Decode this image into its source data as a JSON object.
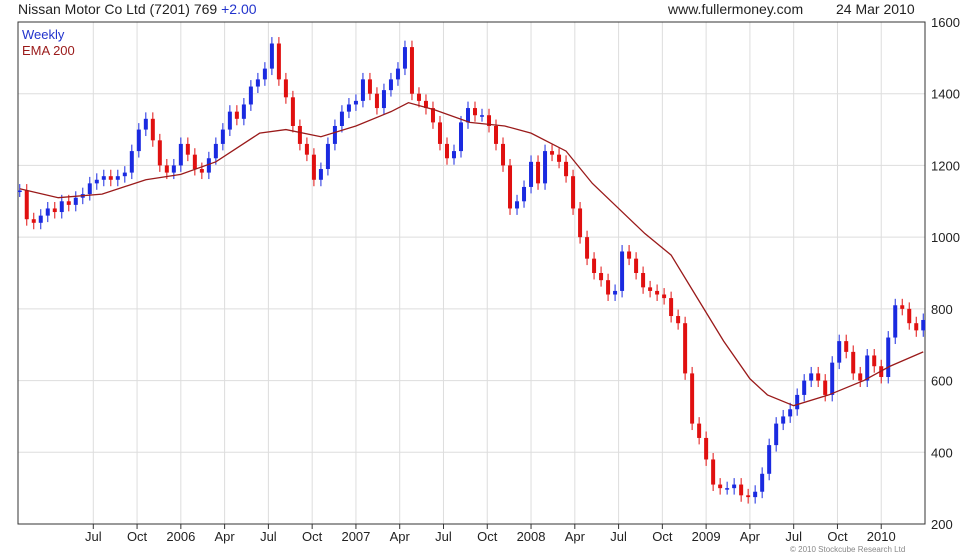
{
  "header": {
    "title": "Nissan Motor Co Ltd (7201) 769",
    "change": "+2.00",
    "site": "www.fullermoney.com",
    "date": "24 Mar 2010"
  },
  "legend": {
    "weekly": "Weekly",
    "ema": "EMA 200"
  },
  "copyright": "© 2010 Stockcube Research Ltd",
  "colors": {
    "up": "#1a2ae0",
    "down": "#e01010",
    "ema": "#9a1a1a",
    "grid": "#dddddd",
    "axis": "#333333"
  },
  "chart_data": {
    "type": "line",
    "ylim": [
      200,
      1600
    ],
    "yticks": [
      200,
      400,
      600,
      800,
      1000,
      1200,
      1400,
      1600
    ],
    "xticks": [
      {
        "label": "Jul",
        "x": 2005.5
      },
      {
        "label": "Oct",
        "x": 2005.75
      },
      {
        "label": "2006",
        "x": 2006.0
      },
      {
        "label": "Apr",
        "x": 2006.25
      },
      {
        "label": "Jul",
        "x": 2006.5
      },
      {
        "label": "Oct",
        "x": 2006.75
      },
      {
        "label": "2007",
        "x": 2007.0
      },
      {
        "label": "Apr",
        "x": 2007.25
      },
      {
        "label": "Jul",
        "x": 2007.5
      },
      {
        "label": "Oct",
        "x": 2007.75
      },
      {
        "label": "2008",
        "x": 2008.0
      },
      {
        "label": "Apr",
        "x": 2008.25
      },
      {
        "label": "Jul",
        "x": 2008.5
      },
      {
        "label": "Oct",
        "x": 2008.75
      },
      {
        "label": "2009",
        "x": 2009.0
      },
      {
        "label": "Apr",
        "x": 2009.25
      },
      {
        "label": "Jul",
        "x": 2009.5
      },
      {
        "label": "Oct",
        "x": 2009.75
      },
      {
        "label": "2010",
        "x": 2010.0
      }
    ],
    "xlim": [
      2005.07,
      2010.25
    ],
    "series": [
      {
        "name": "Weekly",
        "points": [
          [
            2005.08,
            1130
          ],
          [
            2005.12,
            1050
          ],
          [
            2005.16,
            1040
          ],
          [
            2005.2,
            1060
          ],
          [
            2005.24,
            1080
          ],
          [
            2005.28,
            1070
          ],
          [
            2005.32,
            1100
          ],
          [
            2005.36,
            1090
          ],
          [
            2005.4,
            1110
          ],
          [
            2005.44,
            1120
          ],
          [
            2005.48,
            1150
          ],
          [
            2005.52,
            1160
          ],
          [
            2005.56,
            1170
          ],
          [
            2005.6,
            1160
          ],
          [
            2005.64,
            1170
          ],
          [
            2005.68,
            1180
          ],
          [
            2005.72,
            1240
          ],
          [
            2005.76,
            1300
          ],
          [
            2005.8,
            1330
          ],
          [
            2005.84,
            1270
          ],
          [
            2005.88,
            1200
          ],
          [
            2005.92,
            1180
          ],
          [
            2005.96,
            1200
          ],
          [
            2006.0,
            1260
          ],
          [
            2006.04,
            1230
          ],
          [
            2006.08,
            1190
          ],
          [
            2006.12,
            1180
          ],
          [
            2006.16,
            1220
          ],
          [
            2006.2,
            1260
          ],
          [
            2006.24,
            1300
          ],
          [
            2006.28,
            1350
          ],
          [
            2006.32,
            1330
          ],
          [
            2006.36,
            1370
          ],
          [
            2006.4,
            1420
          ],
          [
            2006.44,
            1440
          ],
          [
            2006.48,
            1470
          ],
          [
            2006.52,
            1540
          ],
          [
            2006.56,
            1440
          ],
          [
            2006.6,
            1390
          ],
          [
            2006.64,
            1310
          ],
          [
            2006.68,
            1260
          ],
          [
            2006.72,
            1230
          ],
          [
            2006.76,
            1160
          ],
          [
            2006.8,
            1190
          ],
          [
            2006.84,
            1260
          ],
          [
            2006.88,
            1310
          ],
          [
            2006.92,
            1350
          ],
          [
            2006.96,
            1370
          ],
          [
            2007.0,
            1380
          ],
          [
            2007.04,
            1440
          ],
          [
            2007.08,
            1400
          ],
          [
            2007.12,
            1360
          ],
          [
            2007.16,
            1410
          ],
          [
            2007.2,
            1440
          ],
          [
            2007.24,
            1470
          ],
          [
            2007.28,
            1530
          ],
          [
            2007.32,
            1400
          ],
          [
            2007.36,
            1380
          ],
          [
            2007.4,
            1360
          ],
          [
            2007.44,
            1320
          ],
          [
            2007.48,
            1260
          ],
          [
            2007.52,
            1220
          ],
          [
            2007.56,
            1240
          ],
          [
            2007.6,
            1320
          ],
          [
            2007.64,
            1360
          ],
          [
            2007.68,
            1340
          ],
          [
            2007.72,
            1340
          ],
          [
            2007.76,
            1310
          ],
          [
            2007.8,
            1260
          ],
          [
            2007.84,
            1200
          ],
          [
            2007.88,
            1080
          ],
          [
            2007.92,
            1100
          ],
          [
            2007.96,
            1140
          ],
          [
            2008.0,
            1210
          ],
          [
            2008.04,
            1150
          ],
          [
            2008.08,
            1240
          ],
          [
            2008.12,
            1230
          ],
          [
            2008.16,
            1210
          ],
          [
            2008.2,
            1170
          ],
          [
            2008.24,
            1080
          ],
          [
            2008.28,
            1000
          ],
          [
            2008.32,
            940
          ],
          [
            2008.36,
            900
          ],
          [
            2008.4,
            880
          ],
          [
            2008.44,
            840
          ],
          [
            2008.48,
            850
          ],
          [
            2008.52,
            960
          ],
          [
            2008.56,
            940
          ],
          [
            2008.6,
            900
          ],
          [
            2008.64,
            860
          ],
          [
            2008.68,
            850
          ],
          [
            2008.72,
            840
          ],
          [
            2008.76,
            830
          ],
          [
            2008.8,
            780
          ],
          [
            2008.84,
            760
          ],
          [
            2008.88,
            620
          ],
          [
            2008.92,
            480
          ],
          [
            2008.96,
            440
          ],
          [
            2009.0,
            380
          ],
          [
            2009.04,
            310
          ],
          [
            2009.08,
            300
          ],
          [
            2009.12,
            300
          ],
          [
            2009.16,
            310
          ],
          [
            2009.2,
            280
          ],
          [
            2009.24,
            275
          ],
          [
            2009.28,
            290
          ],
          [
            2009.32,
            340
          ],
          [
            2009.36,
            420
          ],
          [
            2009.4,
            480
          ],
          [
            2009.44,
            500
          ],
          [
            2009.48,
            520
          ],
          [
            2009.52,
            560
          ],
          [
            2009.56,
            600
          ],
          [
            2009.6,
            620
          ],
          [
            2009.64,
            600
          ],
          [
            2009.68,
            560
          ],
          [
            2009.72,
            650
          ],
          [
            2009.76,
            710
          ],
          [
            2009.8,
            680
          ],
          [
            2009.84,
            620
          ],
          [
            2009.88,
            600
          ],
          [
            2009.92,
            670
          ],
          [
            2009.96,
            640
          ],
          [
            2010.0,
            610
          ],
          [
            2010.04,
            720
          ],
          [
            2010.08,
            810
          ],
          [
            2010.12,
            800
          ],
          [
            2010.16,
            760
          ],
          [
            2010.2,
            740
          ],
          [
            2010.24,
            769
          ]
        ]
      },
      {
        "name": "EMA 200",
        "points": [
          [
            2005.08,
            1135
          ],
          [
            2005.3,
            1110
          ],
          [
            2005.55,
            1120
          ],
          [
            2005.8,
            1160
          ],
          [
            2006.0,
            1175
          ],
          [
            2006.2,
            1210
          ],
          [
            2006.45,
            1290
          ],
          [
            2006.6,
            1300
          ],
          [
            2006.8,
            1280
          ],
          [
            2007.0,
            1310
          ],
          [
            2007.2,
            1350
          ],
          [
            2007.3,
            1375
          ],
          [
            2007.45,
            1355
          ],
          [
            2007.65,
            1320
          ],
          [
            2007.85,
            1310
          ],
          [
            2008.0,
            1290
          ],
          [
            2008.2,
            1240
          ],
          [
            2008.35,
            1150
          ],
          [
            2008.5,
            1080
          ],
          [
            2008.65,
            1010
          ],
          [
            2008.8,
            950
          ],
          [
            2008.95,
            830
          ],
          [
            2009.1,
            710
          ],
          [
            2009.25,
            605
          ],
          [
            2009.35,
            560
          ],
          [
            2009.5,
            530
          ],
          [
            2009.7,
            560
          ],
          [
            2009.9,
            600
          ],
          [
            2010.05,
            640
          ],
          [
            2010.24,
            680
          ]
        ]
      }
    ]
  }
}
